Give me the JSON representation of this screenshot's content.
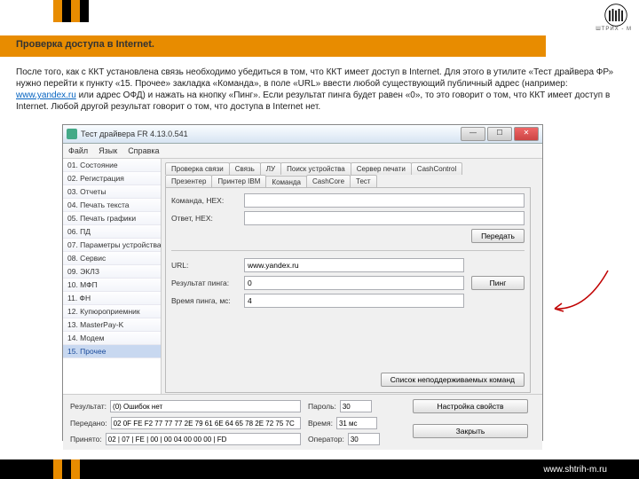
{
  "brand": {
    "name": "ШТРИХ - М",
    "url": "www.shtrih-m.ru"
  },
  "header": {
    "title": "Проверка доступа в Internet."
  },
  "description": {
    "pre": "После того, как с ККТ установлена связь необходимо убедиться в том, что ККТ имеет доступ в Internet. Для этого в утилите «Тест драйвера ФР» нужно перейти к пункту «15. Прочее» закладка «Команда», в поле «URL» ввести любой существующий публичный адрес (например: ",
    "link": "www.yandex.ru",
    "post": " или адрес ОФД) и нажать на кнопку «Пинг». Если результат пинга будет равен «0», то это говорит о том, что ККТ имеет доступ в Internet. Любой другой результат говорит о том, что доступа в Internet нет."
  },
  "window": {
    "title": "Тест драйвера FR 4.13.0.541",
    "menu": [
      "Файл",
      "Язык",
      "Справка"
    ],
    "close_icon": "✕",
    "min_icon": "—",
    "max_icon": "☐"
  },
  "sidebar": {
    "items": [
      "01. Состояние",
      "02. Регистрация",
      "03. Отчеты",
      "04. Печать текста",
      "05. Печать графики",
      "06. ПД",
      "07. Параметры устройства",
      "08. Сервис",
      "09. ЭКЛЗ",
      "10. МФП",
      "11. ФН",
      "12. Купюроприемник",
      "13. MasterPay-K",
      "14. Модем",
      "15. Прочее"
    ],
    "selected_index": 14
  },
  "tabs": {
    "row1": [
      "Проверка связи",
      "Связь",
      "ЛУ",
      "Поиск устройства",
      "Сервер печати",
      "CashControl"
    ],
    "row2": [
      "Презентер",
      "Принтер IBM",
      "Команда",
      "CashCore",
      "Тест"
    ],
    "active": "Команда"
  },
  "fields": {
    "cmd_hex_label": "Команда, HEX:",
    "ans_hex_label": "Ответ, HEX:",
    "send_label": "Передать",
    "url_label": "URL:",
    "url_value": "www.yandex.ru",
    "ping_result_label": "Результат пинга:",
    "ping_result_value": "0",
    "ping_time_label": "Время пинга, мс:",
    "ping_time_value": "4",
    "ping_btn": "Пинг",
    "unsupported_btn": "Список неподдерживаемых команд"
  },
  "bottom": {
    "result_label": "Результат:",
    "result_value": "(0) Ошибок нет",
    "sent_label": "Передано:",
    "sent_value": "02 0F FE F2 77 77 77 2E 79 61 6E 64 65 78 2E 72 75 7C",
    "recv_label": "Принято:",
    "recv_value": "02 | 07 | FE | 00 | 00 04 00 00 00 | FD",
    "password_label": "Пароль:",
    "password_value": "30",
    "time_label": "Время:",
    "time_value": "31 мс",
    "operator_label": "Оператор:",
    "operator_value": "30",
    "props_btn": "Настройка свойств",
    "close_btn": "Закрыть"
  }
}
